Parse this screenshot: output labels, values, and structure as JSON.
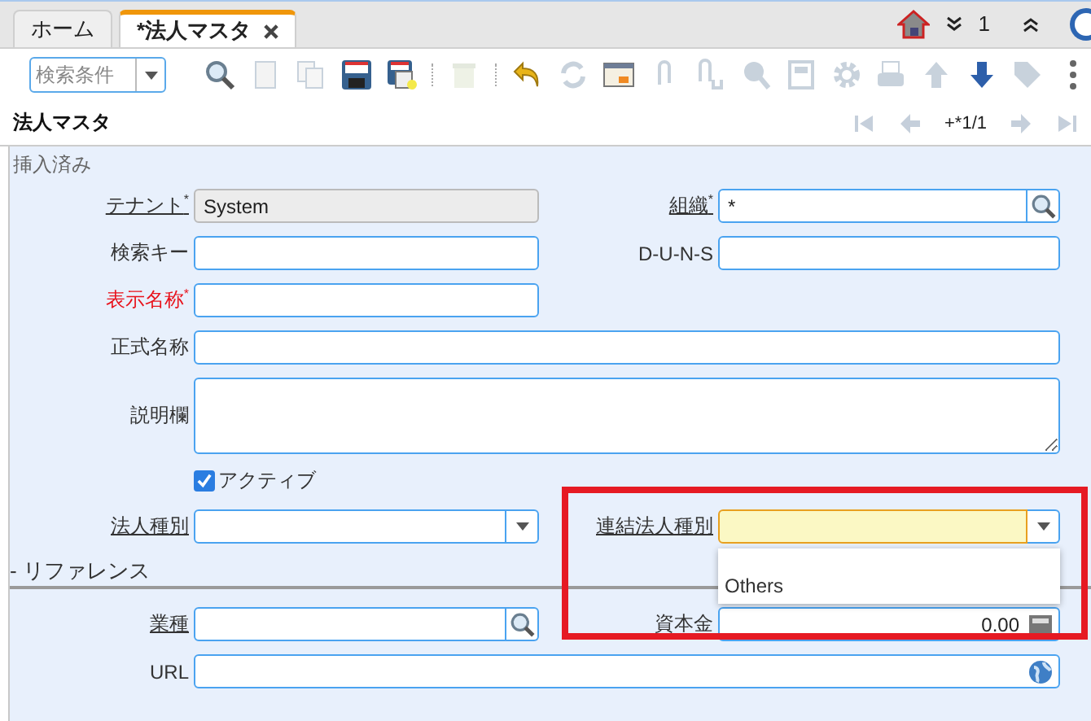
{
  "tabs": [
    {
      "label": "ホーム",
      "selected": false,
      "closable": false
    },
    {
      "label": "*法人マスタ",
      "selected": true,
      "closable": true
    }
  ],
  "header_right": {
    "down_count": "1"
  },
  "toolbar": {
    "search_combo": {
      "placeholder": "検索条件"
    },
    "groups": [
      [
        {
          "kind": "search",
          "disabled": false
        },
        {
          "kind": "new",
          "disabled": true
        },
        {
          "kind": "copy",
          "disabled": true
        },
        {
          "kind": "save",
          "disabled": false
        },
        {
          "kind": "save_new",
          "disabled": false
        }
      ],
      [
        {
          "kind": "delete",
          "disabled": true
        }
      ],
      [
        {
          "kind": "undo",
          "disabled": false
        },
        {
          "kind": "refresh",
          "disabled": true
        },
        {
          "kind": "grid",
          "disabled": false
        },
        {
          "kind": "attach",
          "disabled": true
        },
        {
          "kind": "attach_up",
          "disabled": true
        },
        {
          "kind": "zoom",
          "disabled": true
        },
        {
          "kind": "report",
          "disabled": true
        },
        {
          "kind": "gear",
          "disabled": true
        },
        {
          "kind": "print",
          "disabled": true
        },
        {
          "kind": "up",
          "disabled": true
        },
        {
          "kind": "down",
          "disabled": false
        },
        {
          "kind": "tag",
          "disabled": true
        },
        {
          "kind": "more",
          "disabled": false
        }
      ]
    ]
  },
  "record": {
    "title": "法人マスタ",
    "position": "+*1/1",
    "nav": [
      {
        "kind": "first",
        "disabled": true
      },
      {
        "kind": "prev",
        "disabled": true
      },
      {
        "kind": "next",
        "disabled": true
      },
      {
        "kind": "last",
        "disabled": true
      }
    ]
  },
  "status": "挿入済み",
  "form": [
    {
      "left": {
        "kind": "text",
        "label": "テナント",
        "required": true,
        "linked": true,
        "alert": false,
        "readonly": true,
        "value": "System"
      },
      "right": {
        "kind": "lookup",
        "label": "組織",
        "required": true,
        "linked": true,
        "alert": false,
        "readonly": false,
        "value": "*"
      }
    },
    {
      "left": {
        "kind": "text",
        "label": "検索キー",
        "required": false,
        "linked": false,
        "alert": false,
        "readonly": false
      },
      "right": {
        "kind": "text",
        "label": "D-U-N-S",
        "required": false,
        "linked": false,
        "alert": false,
        "readonly": false
      }
    },
    {
      "left": {
        "kind": "text",
        "label": "表示名称",
        "required": true,
        "linked": false,
        "alert": true,
        "readonly": false
      }
    },
    {
      "wide": {
        "kind": "text",
        "label": "正式名称",
        "required": false,
        "linked": false,
        "alert": false,
        "readonly": false
      }
    },
    {
      "wide": {
        "kind": "textarea",
        "label": "説明欄",
        "required": false,
        "linked": false,
        "alert": false,
        "readonly": false
      }
    },
    {
      "left": {
        "kind": "checkbox",
        "label": "アクティブ",
        "checked": true
      }
    },
    {
      "left": {
        "kind": "combo",
        "label": "法人種別",
        "required": false,
        "linked": true,
        "alert": false,
        "readonly": false,
        "focused": false
      },
      "right": {
        "kind": "combo",
        "label": "連結法人種別",
        "required": false,
        "linked": true,
        "alert": false,
        "readonly": false,
        "focused": true,
        "open": true,
        "options": [
          {
            "label": "Others",
            "selected": false
          }
        ]
      }
    }
  ],
  "reference": {
    "title": "- リファレンス",
    "rows": [
      {
        "left": {
          "kind": "lookup",
          "label": "業種",
          "required": false,
          "linked": true,
          "alert": false,
          "readonly": false
        },
        "right": {
          "kind": "number",
          "label": "資本金",
          "required": false,
          "linked": false,
          "alert": false,
          "readonly": false,
          "value": "0.00"
        }
      },
      {
        "wide": {
          "kind": "url",
          "label": "URL",
          "required": false,
          "linked": false,
          "alert": false,
          "readonly": false
        }
      }
    ]
  },
  "annotation": {
    "kind": "highlight"
  }
}
